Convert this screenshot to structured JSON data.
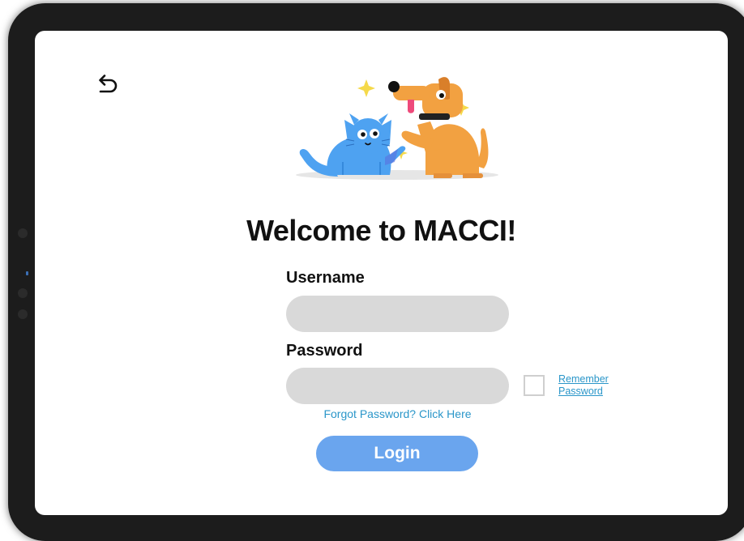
{
  "welcome": {
    "title": "Welcome to MACCI!"
  },
  "form": {
    "username_label": "Username",
    "username_value": "",
    "password_label": "Password",
    "password_value": "",
    "remember_line1": "Remember",
    "remember_line2": "Password",
    "remember_checked": false,
    "forgot_link": "Forgot Password? Click Here",
    "login_label": "Login"
  },
  "icons": {
    "back": "undo-arrow-icon",
    "hero": "cat-and-dog-illustration"
  },
  "colors": {
    "accent": "#6aa5ee",
    "link": "#2a96c9",
    "field_bg": "#d9d9d9",
    "cat": "#4ea2f1",
    "dog": "#f2a141",
    "sparkle": "#f5d94a"
  }
}
